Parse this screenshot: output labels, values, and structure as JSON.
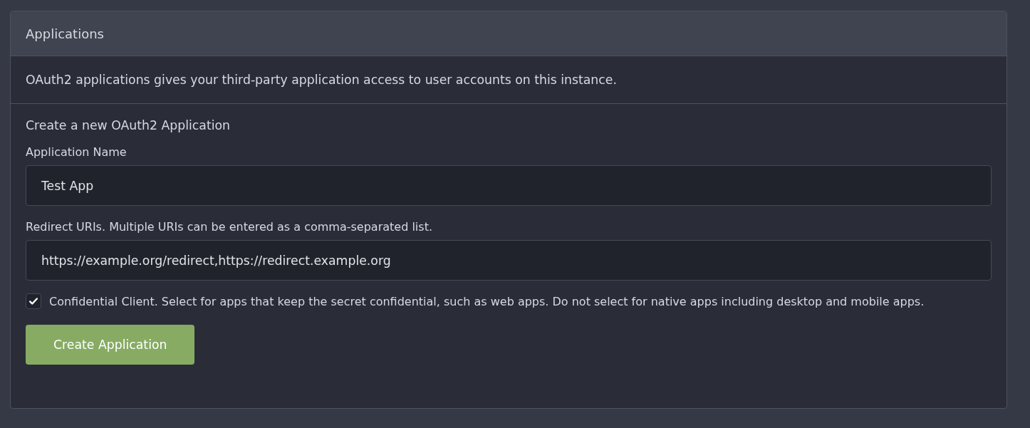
{
  "panel": {
    "title": "Applications",
    "description": "OAuth2 applications gives your third-party application access to user accounts on this instance."
  },
  "form": {
    "heading": "Create a new OAuth2 Application",
    "fields": [
      {
        "label": "Application Name",
        "value": "Test App"
      },
      {
        "label": "Redirect URIs. Multiple URIs can be entered as a comma-separated list.",
        "value": "https://example.org/redirect,https://redirect.example.org"
      }
    ],
    "confidential": {
      "label": "Confidential Client. Select for apps that keep the secret confidential, such as web apps. Do not select for native apps including desktop and mobile apps.",
      "checked": true
    },
    "submit": "Create Application"
  }
}
